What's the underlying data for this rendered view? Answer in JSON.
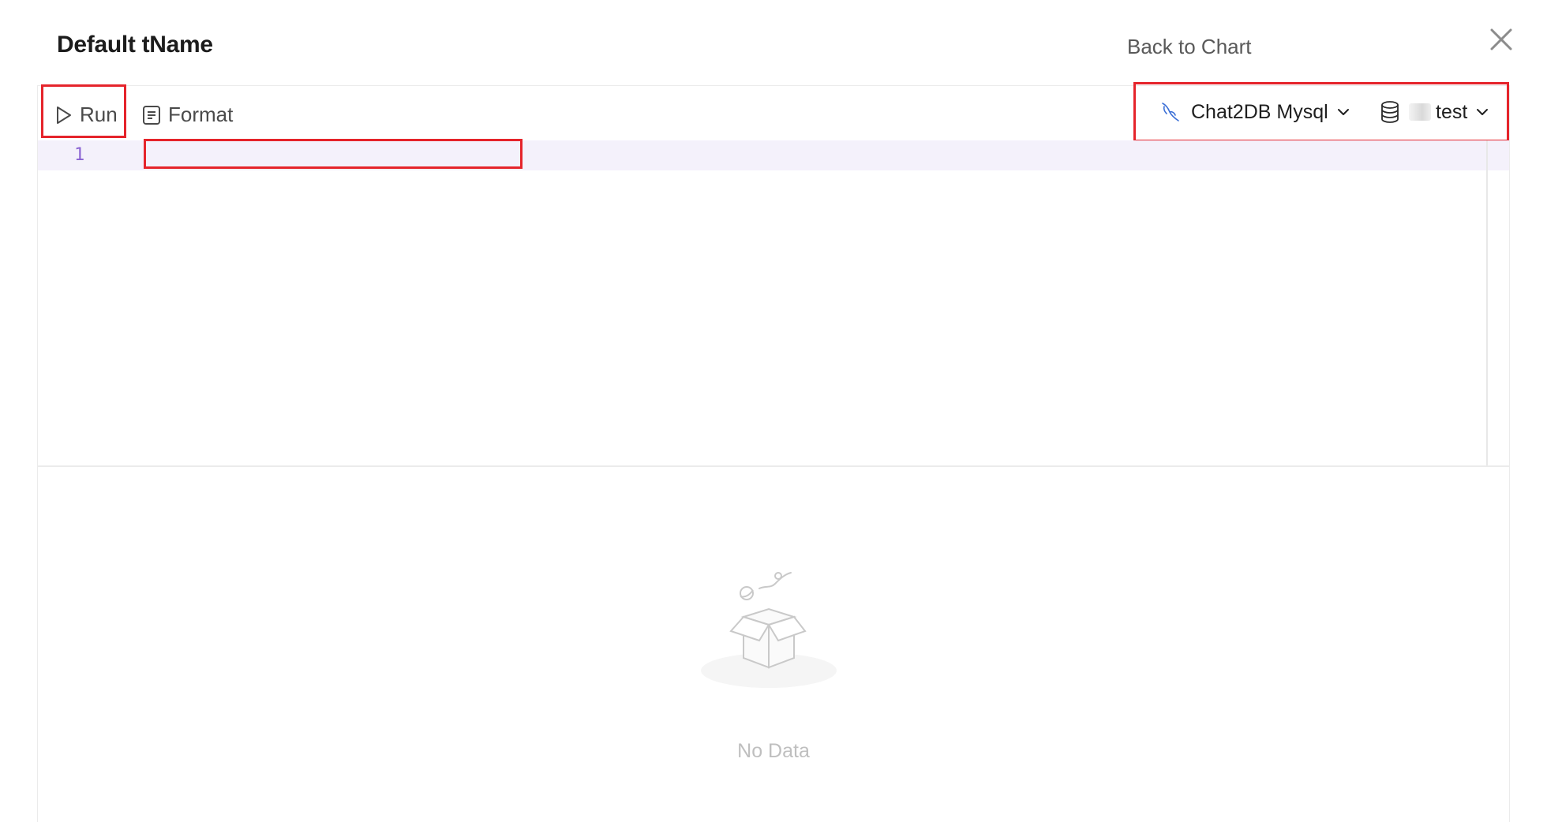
{
  "header": {
    "title": "Default tName",
    "back_link": "Back to Chart",
    "close_icon": "close-icon"
  },
  "toolbar": {
    "run_label": "Run",
    "format_label": "Format",
    "connection": {
      "label": "Chat2DB Mysql",
      "icon": "mysql-dolphin-icon",
      "accent_color": "#3b6fd6"
    },
    "database": {
      "label": "test",
      "icon": "database-icon"
    }
  },
  "editor": {
    "line_numbers": [
      "1"
    ],
    "content": "",
    "active_line_color": "#f4f1fb",
    "line_number_color": "#8a63d2"
  },
  "results": {
    "empty_text": "No Data",
    "empty_icon": "empty-box-icon"
  },
  "highlight_color": "#e5242b"
}
